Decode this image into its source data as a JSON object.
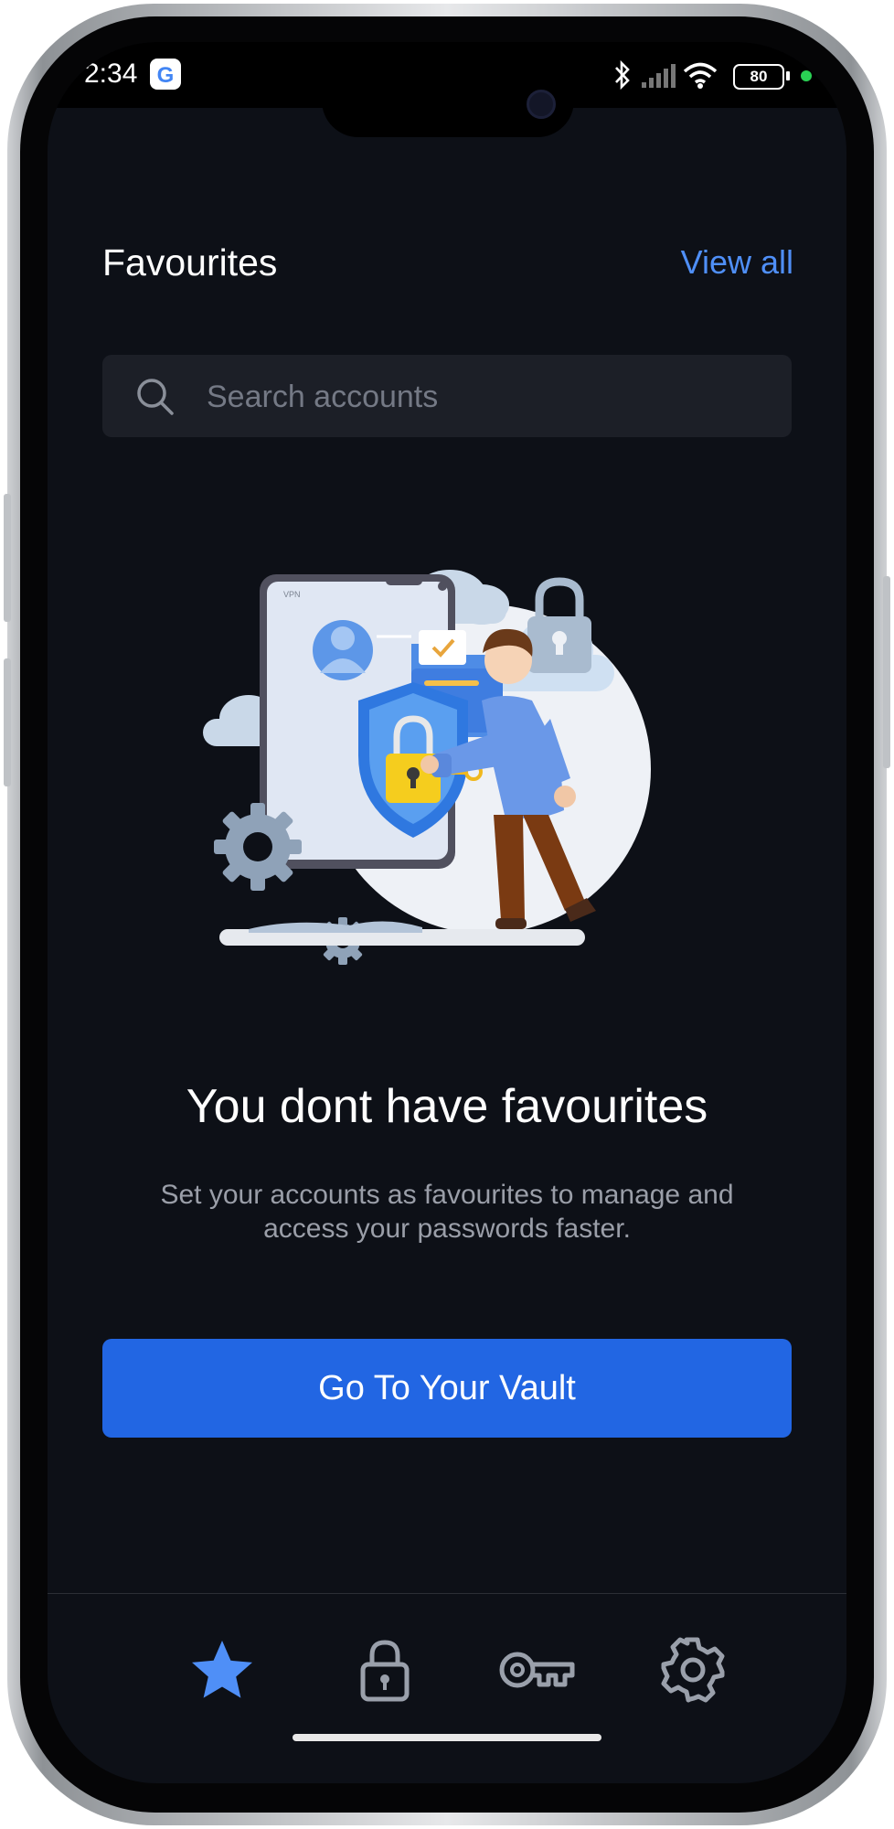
{
  "status_bar": {
    "time": "2:34",
    "battery": "80"
  },
  "header": {
    "title": "Favourites",
    "view_all": "View all"
  },
  "search": {
    "placeholder": "Search accounts"
  },
  "empty_state": {
    "title": "You dont have favourites",
    "description": "Set your accounts as favourites to manage and access your passwords faster.",
    "illustration_text": "VPN"
  },
  "cta": {
    "label": "Go To Your Vault"
  },
  "tab_bar": {
    "active_color": "#4f8ff7",
    "inactive_color": "#9aa0ab",
    "tabs": [
      {
        "icon": "star-icon",
        "active": true
      },
      {
        "icon": "lock-icon",
        "active": false
      },
      {
        "icon": "key-icon",
        "active": false
      },
      {
        "icon": "gear-icon",
        "active": false
      }
    ]
  },
  "colors": {
    "background": "#0d1017",
    "accent": "#2266e3",
    "link": "#4f8ff7",
    "search_bg": "#1c1f27"
  }
}
